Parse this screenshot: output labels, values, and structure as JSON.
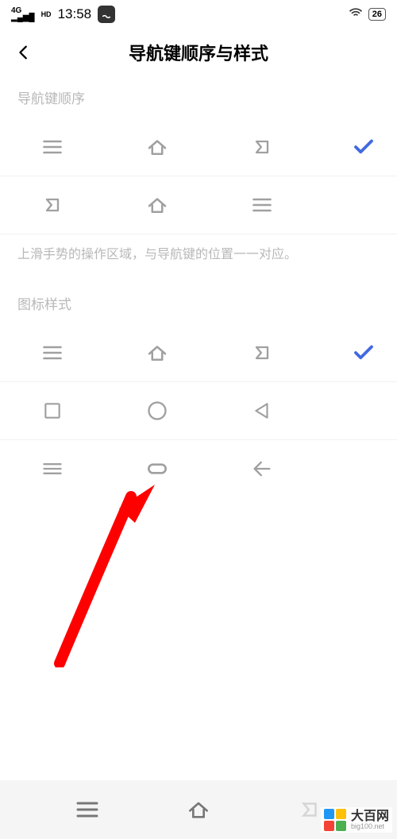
{
  "status": {
    "network": "4G",
    "hd": "HD",
    "time": "13:58",
    "battery": "26"
  },
  "header": {
    "title": "导航键顺序与样式"
  },
  "sections": {
    "order": {
      "label": "导航键顺序",
      "hint": "上滑手势的操作区域，与导航键的位置一一对应。"
    },
    "style": {
      "label": "图标样式"
    }
  },
  "watermark": {
    "main": "大百网",
    "sub": "big100.net"
  }
}
